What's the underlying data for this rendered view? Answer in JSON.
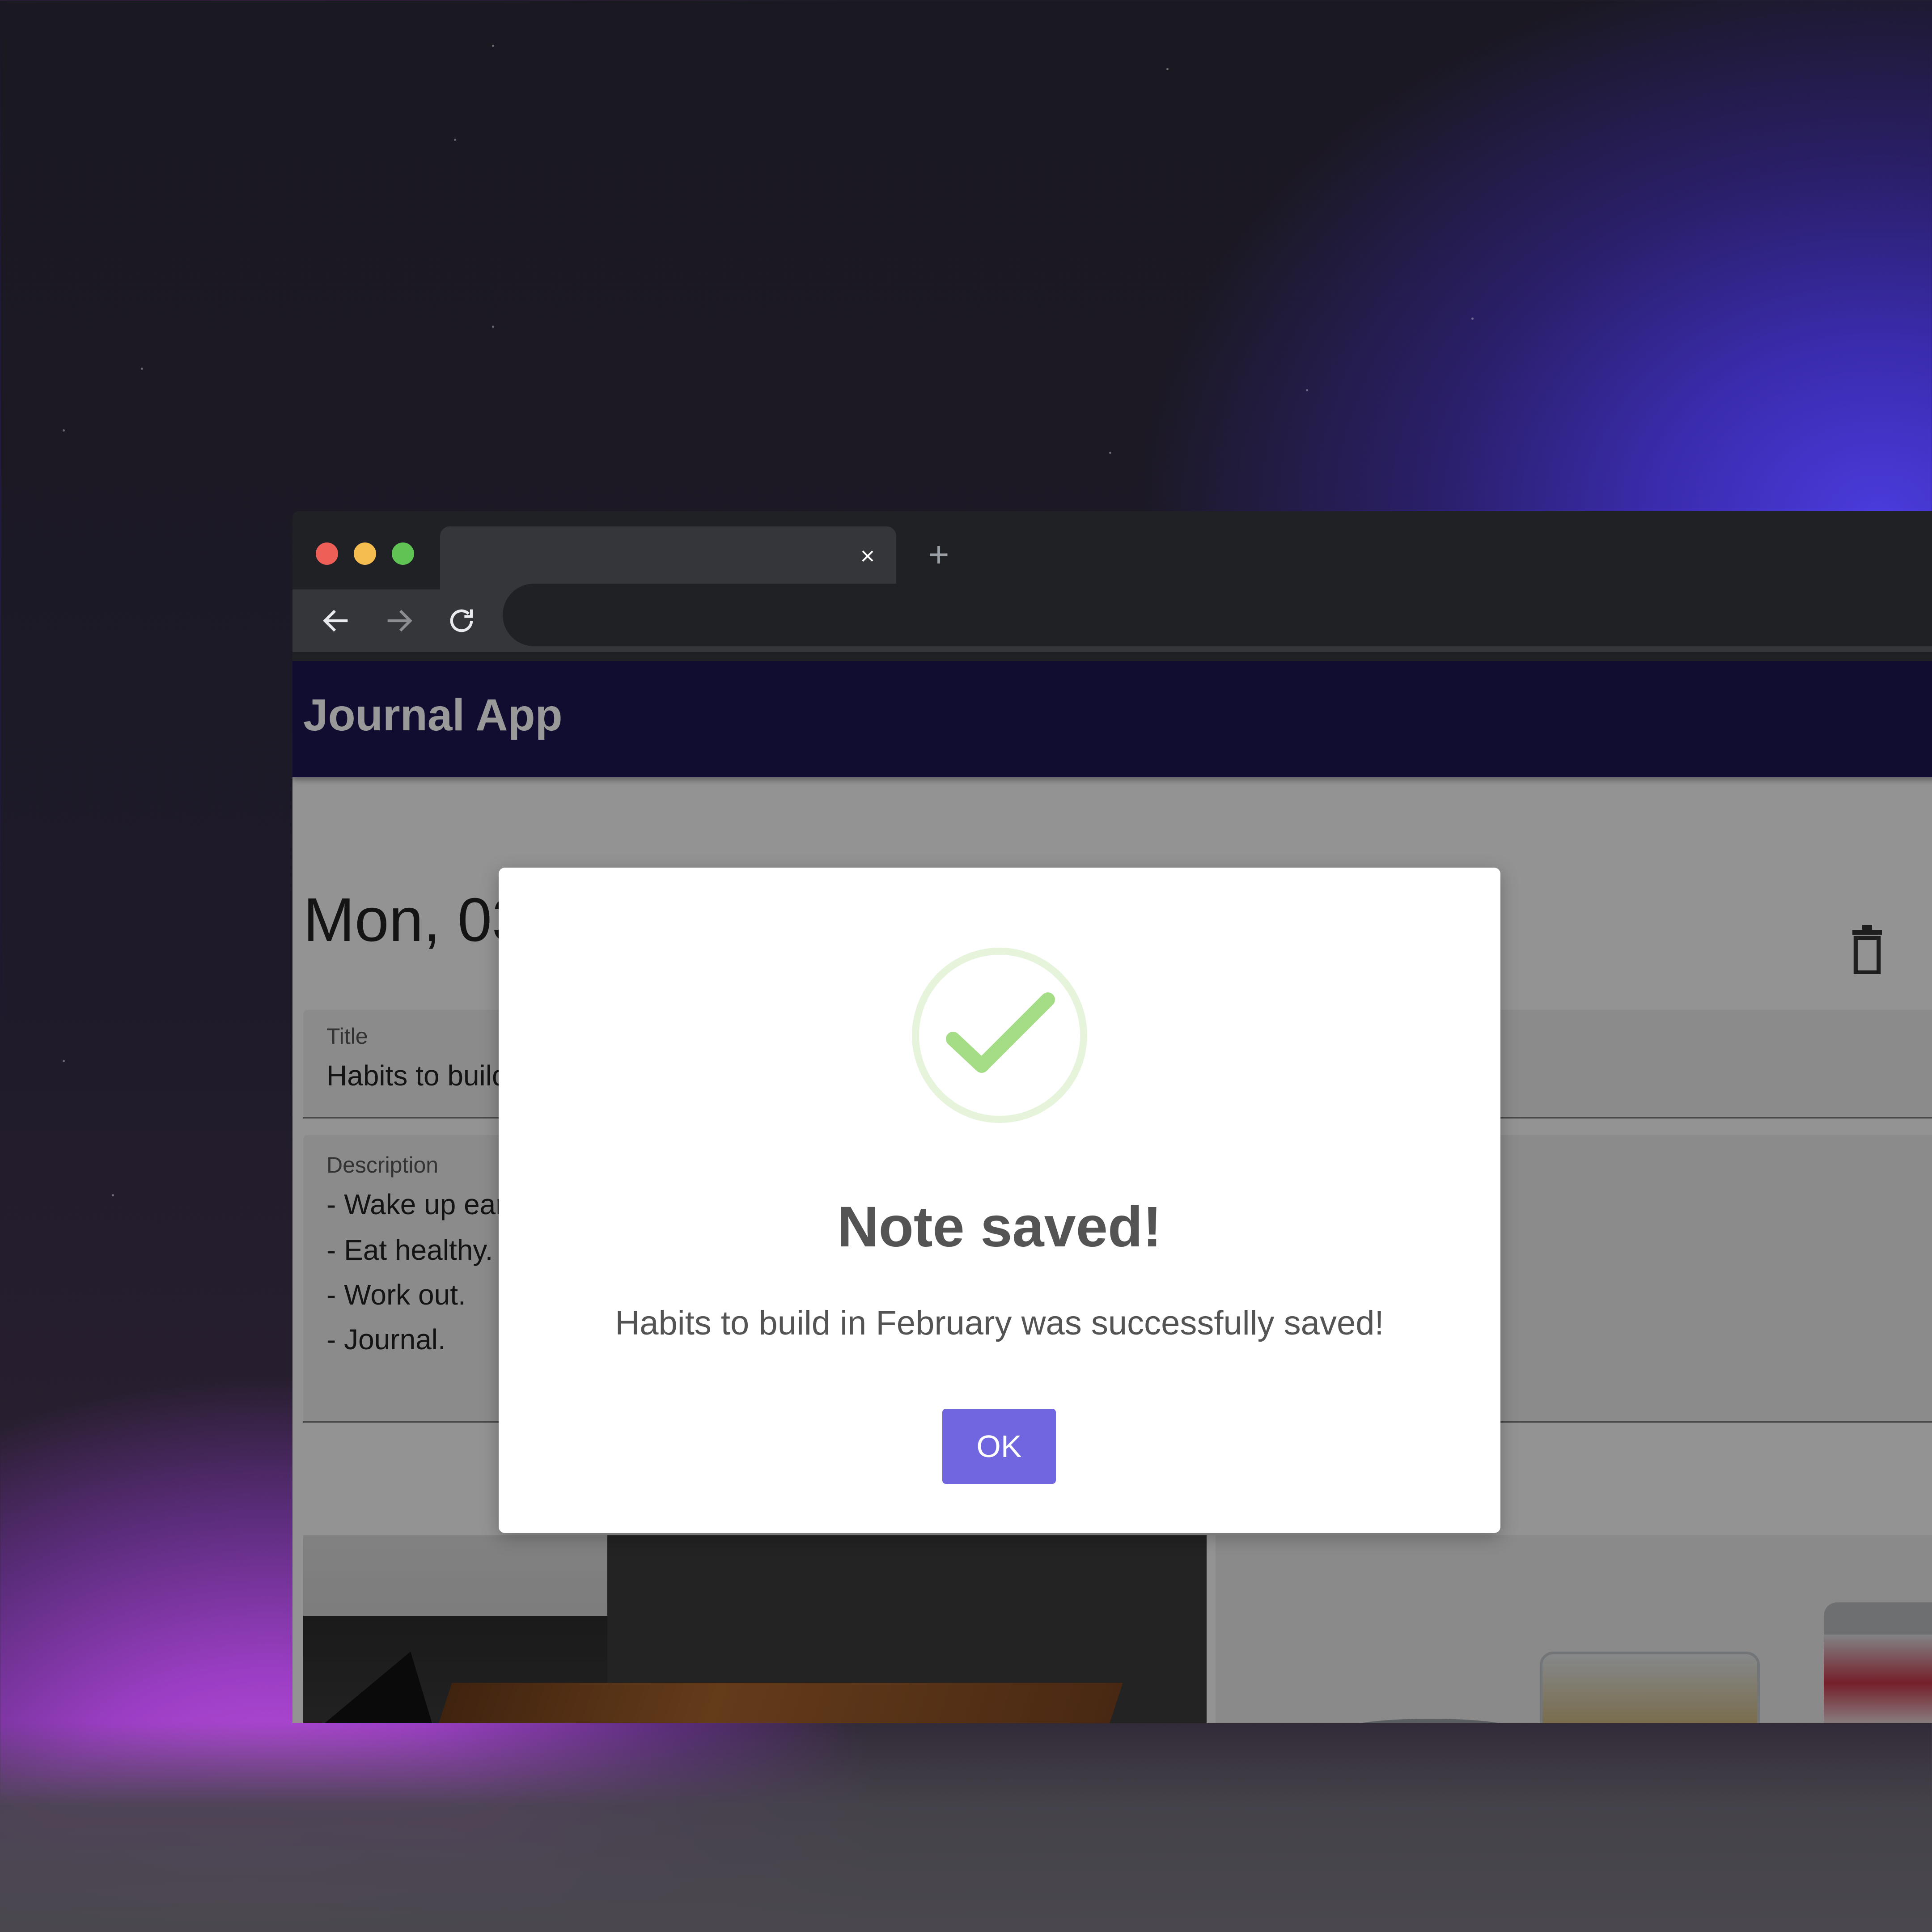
{
  "app": {
    "title": "Journal App"
  },
  "browser": {
    "tab_close_symbol": "×",
    "new_tab_symbol": "+",
    "back_icon": "arrow-left-icon",
    "forward_icon": "arrow-right-icon",
    "reload_icon": "reload-icon"
  },
  "note": {
    "date": "Mon, 03 Feb 2025 15:15:46 GMT",
    "title_label": "Title",
    "title_value": "Habits to build in February",
    "description_label": "Description",
    "description_lines": [
      "- Wake up early.",
      "- Eat healthy.",
      "- Work out.",
      "- Journal."
    ],
    "delete_icon": "trash-icon"
  },
  "dialog": {
    "icon": "success-check-icon",
    "title": "Note saved!",
    "message": "Habits to build in February was successfully saved!",
    "ok_label": "OK"
  },
  "colors": {
    "app_bar": "#1d1650",
    "dialog_button": "#7066e0",
    "success_green": "#a5dc86"
  }
}
